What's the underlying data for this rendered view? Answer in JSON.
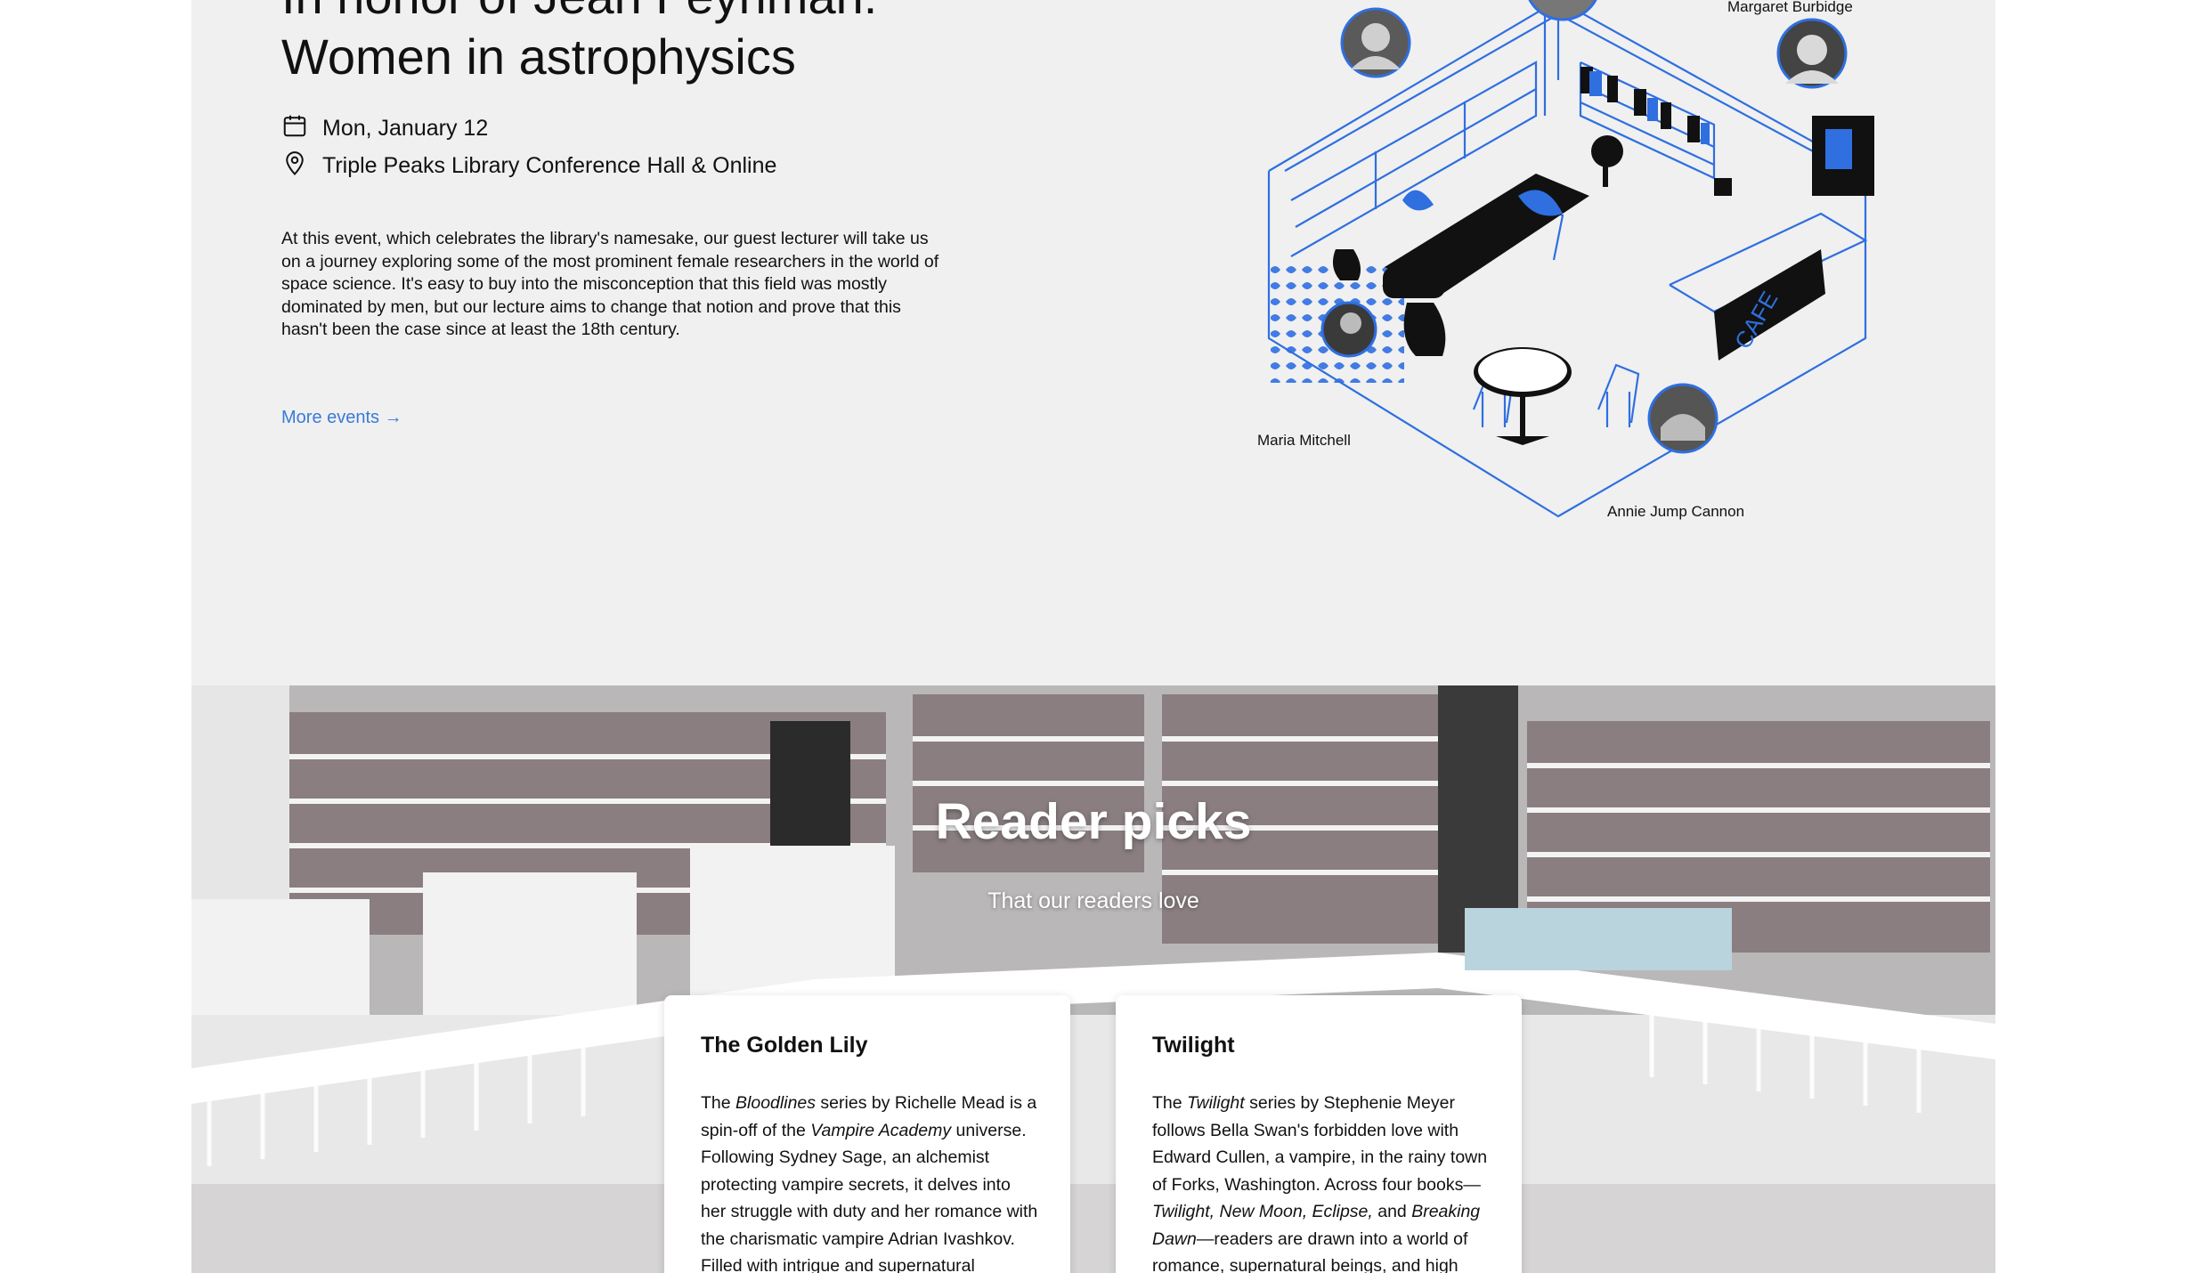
{
  "event": {
    "title_line1": "In honor of Jean Feynman:",
    "title_line2": "Women in astrophysics",
    "date": "Mon, January 12",
    "location": "Triple Peaks Library Conference Hall & Online",
    "description": "At this event, which celebrates the library's namesake, our guest lecturer will take us on a journey exploring some of the most prominent female researchers in the world of space science. It's easy to buy into the misconception that this field was mostly dominated by men, but our lecture aims to change that notion and prove that this hasn't been the case since at least the 18th century.",
    "more_link": "More events →",
    "portraits": {
      "burbidge": "Margaret Burbidge",
      "mitchell": "Maria Mitchell",
      "cannon": "Annie Jump Cannon"
    },
    "cafe_sign": "CAFE"
  },
  "picks": {
    "title": "Reader picks",
    "subtitle": "That our readers love",
    "cards": [
      {
        "title": "The Golden Lily",
        "parts": [
          "The ",
          "Bloodlines",
          " series by Richelle Mead is a spin-off of the ",
          "Vampire Academy",
          " universe. Following Sydney Sage, an alchemist protecting vampire secrets, it delves into her struggle with duty and her romance with the charismatic vampire Adrian Ivashkov. Filled with intrigue and supernatural elements, the"
        ]
      },
      {
        "title": "Twilight",
        "parts": [
          "The ",
          "Twilight",
          " series by Stephenie Meyer follows Bella Swan's forbidden love with Edward Cullen, a vampire, in the rainy town of Forks, Washington. Across four books—",
          "Twilight, New Moon, Eclipse,",
          " and ",
          "Breaking Dawn",
          "—readers are drawn into a world of romance, supernatural beings, and high school drama."
        ]
      }
    ]
  },
  "colors": {
    "accent_blue": "#3b7ad9",
    "illustration_blue": "#2f6fe0",
    "event_bg": "#f0f0f0"
  },
  "icons": {
    "date": "calendar-icon",
    "location": "map-pin-icon"
  }
}
